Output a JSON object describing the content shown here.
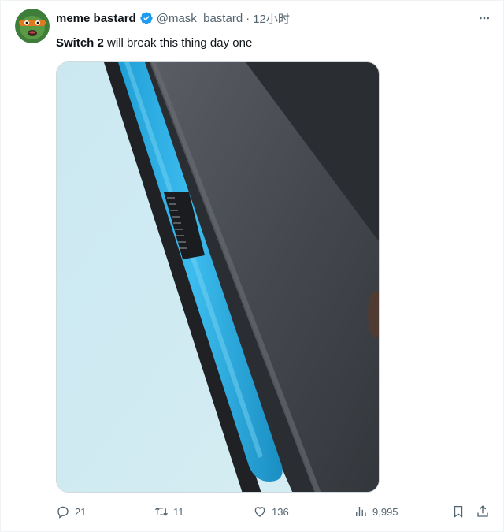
{
  "tweet": {
    "author": {
      "display_name": "meme bastard",
      "handle": "@mask_bastard",
      "verified": true,
      "avatar_icon": "ninja-turtle-avatar"
    },
    "separator": "·",
    "timestamp": "12小时",
    "text_bold": "Switch 2",
    "text_rest": " will break this thing day one",
    "media": {
      "description_icon": "console-side-photo",
      "background_color": "#cfe9f1",
      "accent_color": "#2eb1e6"
    },
    "actions": {
      "replies": "21",
      "retweets": "11",
      "likes": "136",
      "views": "9,995"
    },
    "colors": {
      "verified_blue": "#1d9bf0",
      "secondary_text": "#536471"
    }
  }
}
